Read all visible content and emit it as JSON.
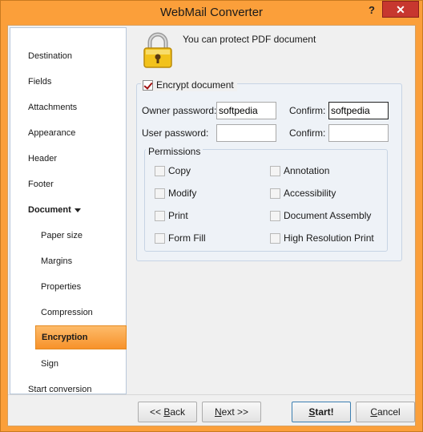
{
  "window": {
    "title": "WebMail Converter",
    "help_label": "?",
    "close_label": "✕"
  },
  "sidebar": {
    "items": [
      {
        "label": "Destination"
      },
      {
        "label": "Fields"
      },
      {
        "label": "Attachments"
      },
      {
        "label": "Appearance"
      },
      {
        "label": "Header"
      },
      {
        "label": "Footer"
      },
      {
        "label": "Document"
      },
      {
        "label": "Paper size"
      },
      {
        "label": "Margins"
      },
      {
        "label": "Properties"
      },
      {
        "label": "Compression"
      },
      {
        "label": "Encryption"
      },
      {
        "label": "Sign"
      },
      {
        "label": "Start conversion"
      }
    ],
    "selected": "Encryption"
  },
  "content": {
    "header_text": "You can protect PDF document",
    "icon": "lock-icon",
    "encrypt": {
      "label": "Encrypt document",
      "checked": true
    },
    "owner": {
      "label": "Owner password:",
      "value": "softpedia",
      "confirm_label": "Confirm:",
      "confirm_value": "softpedia"
    },
    "user": {
      "label": "User password:",
      "value": "",
      "confirm_label": "Confirm:",
      "confirm_value": ""
    },
    "permissions": {
      "title": "Permissions",
      "items": [
        {
          "label": "Copy",
          "checked": false
        },
        {
          "label": "Annotation",
          "checked": false
        },
        {
          "label": "Modify",
          "checked": false
        },
        {
          "label": "Accessibility",
          "checked": false
        },
        {
          "label": "Print",
          "checked": false
        },
        {
          "label": "Document Assembly",
          "checked": false
        },
        {
          "label": "Form Fill",
          "checked": false
        },
        {
          "label": "High Resolution Print",
          "checked": false
        }
      ]
    }
  },
  "buttons": {
    "back_prefix": "<< ",
    "back_key": "B",
    "back_rest": "ack",
    "next_key": "N",
    "next_rest": "ext >>",
    "start_key": "S",
    "start_rest": "tart!",
    "cancel_key": "C",
    "cancel_rest": "ancel"
  },
  "colors": {
    "frame": "#fb9f3a",
    "selected": "#f7922a",
    "close": "#c7372f"
  }
}
